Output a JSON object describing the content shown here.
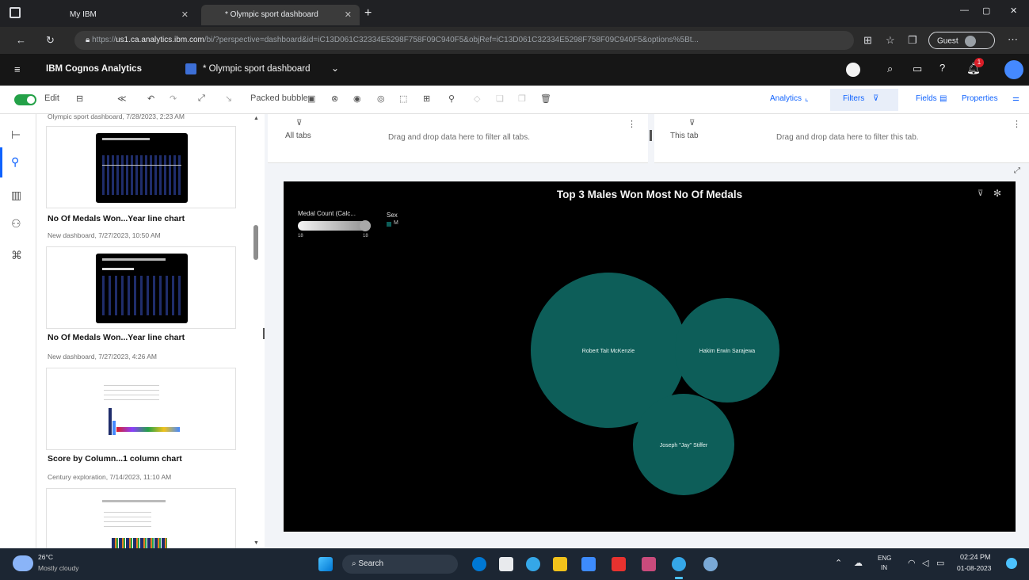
{
  "browser": {
    "tabs": [
      {
        "label": "My IBM"
      },
      {
        "label": "* Olympic sport dashboard"
      }
    ],
    "new_tab": "+",
    "url_prefix": "https://",
    "url_domain": "us1.ca.analytics.ibm.com",
    "url_rest": "/bi/?perspective=dashboard&id=iC13D061C32334E5298F758F09C940F5&objRef=iC13D061C32334E5298F758F09C940F5&options%5Bt...",
    "profile": "Guest"
  },
  "app": {
    "product": "IBM Cognos Analytics",
    "doc_title": "* Olympic sport dashboard",
    "notification_count": "1"
  },
  "toolbar": {
    "edit_label": "Edit",
    "viz_type": "Packed bubble",
    "analytics": "Analytics",
    "filters": "Filters",
    "fields": "Fields",
    "properties": "Properties"
  },
  "panel": {
    "top_partial": "Olympic sport dashboard, 7/28/2023, 2:23 AM",
    "cards": [
      {
        "title": "No Of Medals Won...Year line chart",
        "subtitle": "New dashboard, 7/27/2023, 10:50 AM"
      },
      {
        "title": "No Of Medals Won...Year line chart",
        "subtitle": "New dashboard, 7/27/2023, 4:26 AM"
      },
      {
        "title": "Score by Column...1 column chart",
        "subtitle": "Century exploration, 7/14/2023, 11:10 AM"
      }
    ]
  },
  "filters": {
    "all_tabs_label": "All tabs",
    "all_tabs_hint": "Drag and drop data here to filter all tabs.",
    "this_tab_label": "This tab",
    "this_tab_hint": "Drag and drop data here to filter this tab."
  },
  "viz": {
    "title": "Top 3 Males Won Most No Of Medals",
    "slider_label": "Medal Count (Calc...",
    "slider_min": "18",
    "slider_max": "18",
    "legend_title": "Sex",
    "legend_item": "M",
    "bubble_color": "#0d5e59"
  },
  "chart_data": {
    "type": "bubble",
    "title": "Top 3 Males Won Most No Of Medals",
    "size_measure": "Medal Count (Calc...",
    "color_by": "Sex",
    "series": [
      {
        "name": "Robert Tait McKenzie",
        "sex": "M"
      },
      {
        "name": "Hakim Erwin Sarajewa",
        "sex": "M"
      },
      {
        "name": "Joseph \"Jay\" Stiffer",
        "sex": "M"
      }
    ]
  },
  "taskbar": {
    "weather_temp": "26°C",
    "weather_desc": "Mostly cloudy",
    "search": "Search",
    "lang1": "ENG",
    "lang2": "IN",
    "time": "02:24 PM",
    "date": "01-08-2023"
  }
}
